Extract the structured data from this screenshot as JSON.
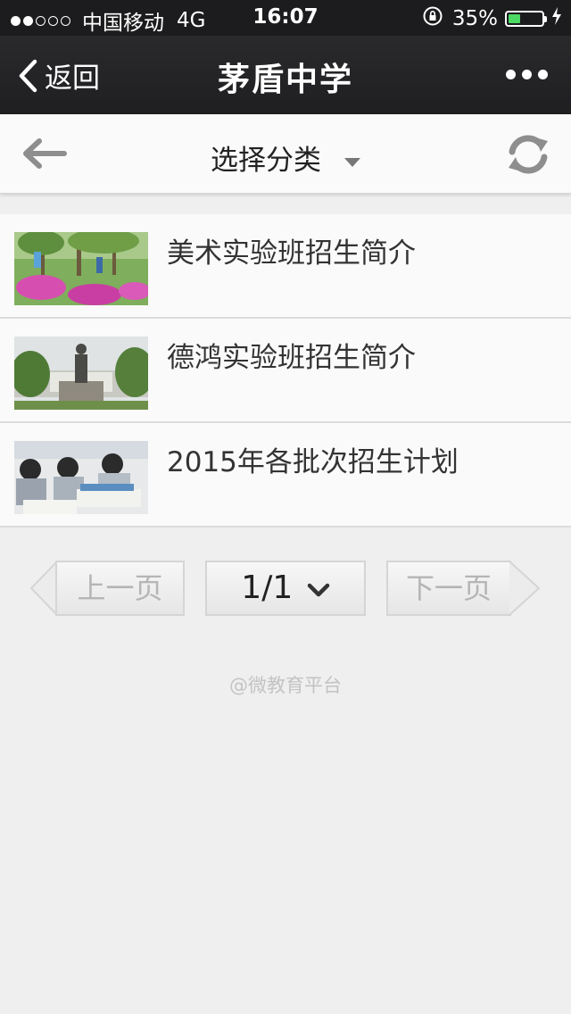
{
  "status_bar": {
    "carrier": "中国移动",
    "network": "4G",
    "time": "16:07",
    "battery_percent": "35%",
    "battery_level": 0.35,
    "signal_bars": 2
  },
  "nav": {
    "back_label": "返回",
    "title": "茅盾中学"
  },
  "toolbar": {
    "category_label": "选择分类"
  },
  "list": {
    "items": [
      {
        "title": "美术实验班招生简介"
      },
      {
        "title": "德鸿实验班招生简介"
      },
      {
        "title": "2015年各批次招生计划"
      }
    ]
  },
  "pager": {
    "prev_label": "上一页",
    "page_label": "1/1",
    "next_label": "下一页"
  },
  "footer": {
    "text": "@微教育平台"
  },
  "colors": {
    "nav_bg": "#1f1f22",
    "battery_fill": "#4cd964",
    "page_bg": "#efefef"
  }
}
